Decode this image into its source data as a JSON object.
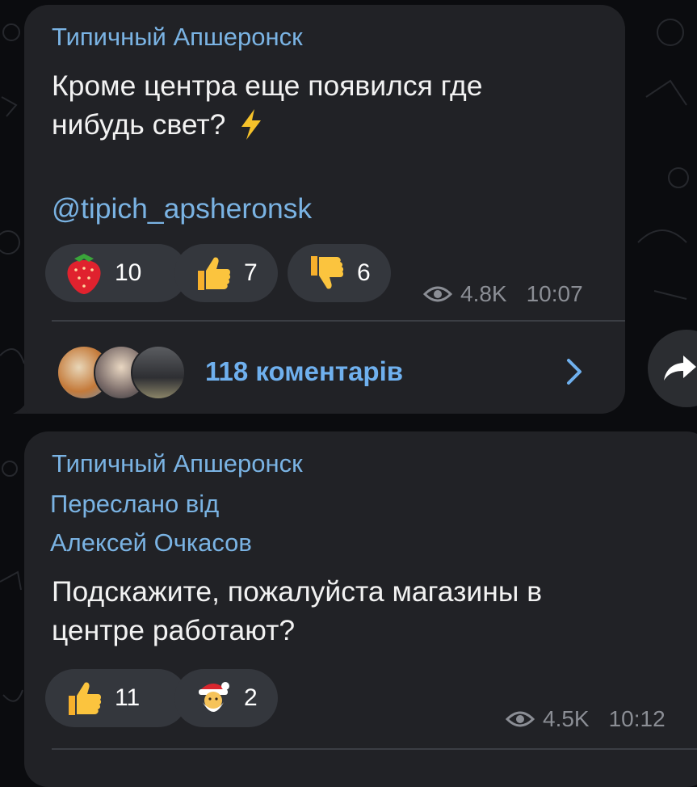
{
  "messages": [
    {
      "channel": "Типичный Апшеронск",
      "text_line1": "Кроме центра еще появился где",
      "text_line2": "нибудь свет?",
      "link": "@tipich_apsheronsk",
      "reactions": [
        {
          "icon": "strawberry-icon",
          "count": "10"
        },
        {
          "icon": "thumbs-up-icon",
          "count": "7"
        },
        {
          "icon": "thumbs-down-icon",
          "count": "6"
        }
      ],
      "views": "4.8K",
      "time": "10:07",
      "comments_label": "118 коментарів"
    },
    {
      "channel": "Типичный Апшеронск",
      "forwarded_label": "Переслано від",
      "forwarded_from": "Алексей Очкасов",
      "text_line1": "Подскажите, пожалуйста магазины в",
      "text_line2": "центре работают?",
      "reactions": [
        {
          "icon": "thumbs-up-icon",
          "count": "11"
        },
        {
          "icon": "santa-icon",
          "count": "2"
        }
      ],
      "views": "4.5K",
      "time": "10:12"
    }
  ],
  "colors": {
    "background": "#0b0c0f",
    "bubble": "#212226",
    "accent": "#7ab3e3",
    "reaction_bg": "#34373d",
    "meta": "#8b8e95"
  }
}
